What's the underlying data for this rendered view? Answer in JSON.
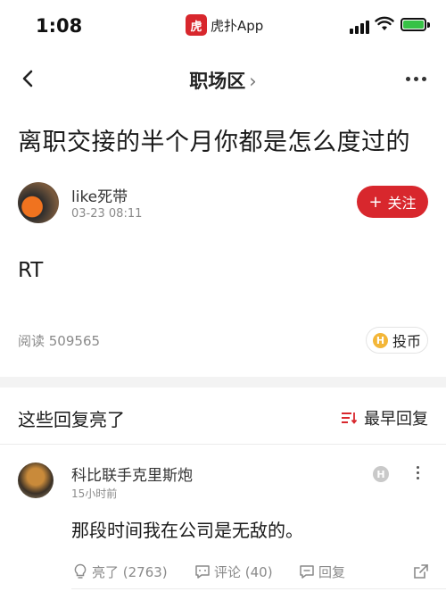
{
  "status_bar": {
    "time": "1:08",
    "app_logo": "虎",
    "app_name": "虎扑App",
    "battery_color": "#37c246"
  },
  "nav": {
    "title": "职场区",
    "chevron": "›"
  },
  "post": {
    "title": "离职交接的半个月你都是怎么度过的",
    "author": "like死带",
    "time": "03-23 08:11",
    "follow_label": "关注",
    "follow_plus": "+",
    "body": "RT",
    "read_count": "阅读 509565",
    "coin_label": "投币",
    "coin_icon_letter": "H"
  },
  "replies": {
    "title": "这些回复亮了",
    "sort_label": "最早回复",
    "items": [
      {
        "name": "科比联手克里斯炮",
        "time": "15小时前",
        "badge": "H",
        "text": "那段时间我在公司是无敌的。",
        "like": "亮了 (2763)",
        "comment": "评论 (40)",
        "reply": "回复"
      }
    ]
  },
  "colors": {
    "accent": "#d8272d",
    "muted": "#8a8a8a",
    "coin": "#f3b638"
  }
}
